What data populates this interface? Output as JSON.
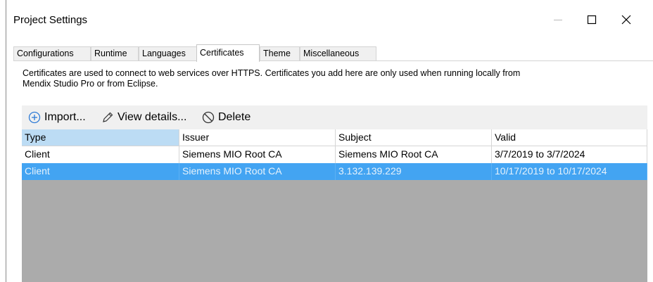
{
  "window": {
    "title": "Project Settings",
    "controls": {
      "minimize": "minimize",
      "maximize": "maximize",
      "close": "close"
    }
  },
  "tabs": [
    {
      "label": "Configurations",
      "active": false
    },
    {
      "label": "Runtime",
      "active": false
    },
    {
      "label": "Languages",
      "active": false
    },
    {
      "label": "Certificates",
      "active": true
    },
    {
      "label": "Theme",
      "active": false
    },
    {
      "label": "Miscellaneous",
      "active": false
    }
  ],
  "description": {
    "line1": "Certificates are used to connect to web services over HTTPS. Certificates you add here are only used when running locally from",
    "line2": "Mendix Studio Pro or from Eclipse."
  },
  "toolbar": {
    "import_label": "Import...",
    "view_details_label": "View details...",
    "delete_label": "Delete",
    "icons": {
      "import": "plus-circle-icon",
      "view_details": "pencil-icon",
      "delete": "no-entry-icon"
    }
  },
  "table": {
    "columns": [
      "Type",
      "Issuer",
      "Subject",
      "Valid"
    ],
    "rows": [
      {
        "type": "Client",
        "issuer": "Siemens MIO Root CA",
        "subject": "Siemens MIO Root CA",
        "valid": "3/7/2019 to 3/7/2024",
        "selected": false
      },
      {
        "type": "Client",
        "issuer": "Siemens MIO Root CA",
        "subject": "3.132.139.229",
        "valid": "10/17/2019 to 10/17/2024",
        "selected": true
      }
    ]
  },
  "colors": {
    "selection": "#43a4f2",
    "sorted_header": "#bcdcf4",
    "grid_empty": "#ababab",
    "toolbar_bg": "#f0f0f0",
    "accent_icon": "#2e7bd6"
  }
}
